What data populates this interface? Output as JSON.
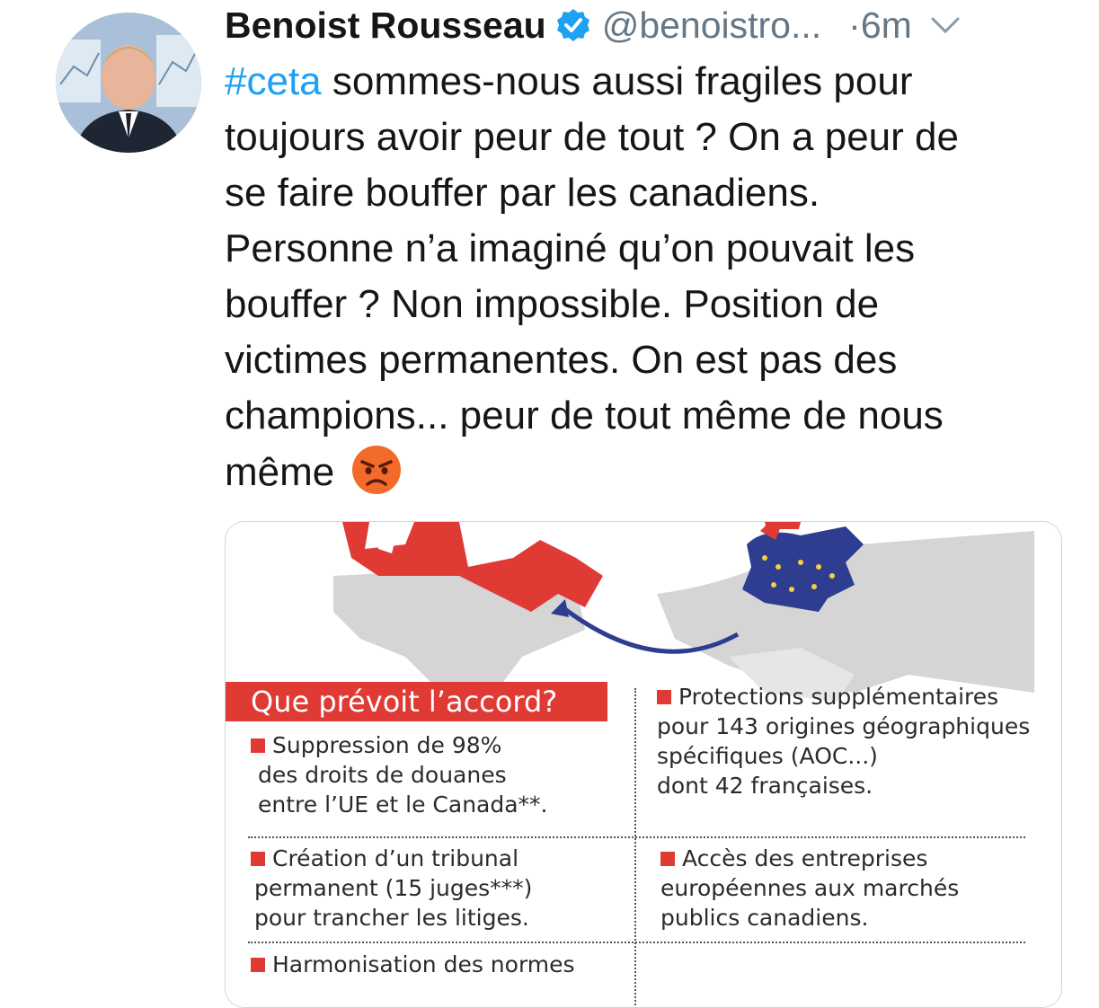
{
  "tweet": {
    "author_name": "Benoist Rousseau",
    "handle": "@benoistro...",
    "separator": "·",
    "time": "6m",
    "hashtag": "#ceta",
    "text_lines": [
      " sommes-nous aussi fragiles pour",
      "toujours avoir peur de tout ? On a peur de",
      "se faire bouffer par les canadiens.",
      "Personne n’a imaginé qu’on pouvait les",
      "bouffer ? Non impossible. Position de",
      "victimes permanentes. On est pas des",
      "champions... peur de tout même de nous",
      "même"
    ],
    "emoji": "angry-face",
    "colors": {
      "link": "#1da1f2",
      "secondary": "#657786",
      "verified": "#1da1f2"
    }
  },
  "media": {
    "banner_title": "Que prévoit l’accord?",
    "items": [
      {
        "lines": [
          "Suppression de 98%",
          "des droits de douanes",
          "entre l’UE et le Canada**."
        ]
      },
      {
        "lines": [
          "Protections supplémentaires",
          "pour 143 origines géographiques",
          "spécifiques (AOC...)",
          "dont 42 françaises."
        ]
      },
      {
        "lines": [
          "Création d’un tribunal",
          "permanent (15 juges***)",
          "pour trancher les litiges."
        ]
      },
      {
        "lines": [
          "Accès des entreprises",
          "européennes aux marchés",
          "publics  canadiens."
        ]
      },
      {
        "lines": [
          "Harmonisation des normes"
        ]
      }
    ],
    "colors": {
      "canada": "#e03a35",
      "eu": "#2e3d8f",
      "land": "#d5d5d5",
      "arrow": "#2e3d8f"
    }
  }
}
